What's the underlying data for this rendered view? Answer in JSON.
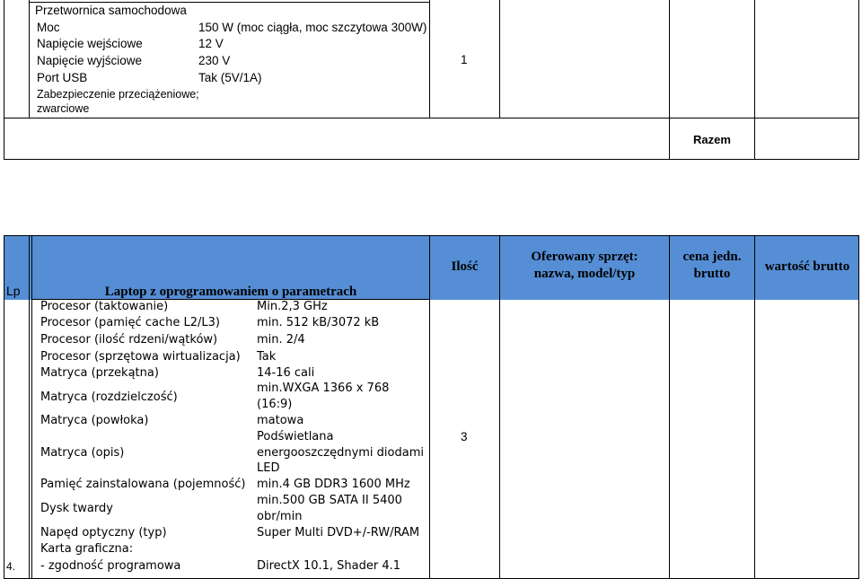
{
  "top_item": {
    "title": "Przetwornica samochodowa",
    "specs": [
      {
        "name": "Moc",
        "value": "150 W (moc ciągła, moc szczytowa 300W)"
      },
      {
        "name": "Napięcie wejściowe",
        "value": "12 V"
      },
      {
        "name": "Napięcie wyjściowe",
        "value": "230 V"
      },
      {
        "name": "Port USB",
        "value": "Tak (5V/1A)"
      }
    ],
    "protection_line1": "Zabezpieczenie przeciążeniowe;",
    "protection_line2": "zwarciowe",
    "quantity": "1"
  },
  "summary": {
    "label": "Razem"
  },
  "header": {
    "lp": "Lp",
    "title": "Laptop z oprogramowaniem o parametrach",
    "quantity": "Ilość",
    "offered_line1": "Oferowany sprzęt:",
    "offered_line2": "nazwa, model/typ",
    "price_line1": "cena jedn.",
    "price_line2": "brutto",
    "value": "wartość brutto",
    "header_bg": "#558ed5"
  },
  "laptop": {
    "number": "4.",
    "quantity": "3",
    "specs": [
      {
        "name": "Procesor (taktowanie)",
        "value": "Min.2,3 GHz"
      },
      {
        "name": "Procesor (pamięć cache L2/L3)",
        "value": "min. 512 kB/3072 kB"
      },
      {
        "name": "Procesor (ilość rdzeni/wątków)",
        "value": "min. 2/4"
      },
      {
        "name": "Procesor (sprzętowa wirtualizacja)",
        "value": "Tak"
      },
      {
        "name": "Matryca (przekątna)",
        "value": "14-16 cali"
      },
      {
        "name": "Matryca (rozdzielczość)",
        "value1": "min.WXGA 1366 x 768",
        "value2": "(16:9)"
      },
      {
        "name": "Matryca (powłoka)",
        "value": "matowa"
      },
      {
        "name": "Matryca (opis)",
        "value1": "Podświetlana",
        "value2": "energooszczędnymi diodami",
        "value3": "LED"
      },
      {
        "name": "Pamięć zainstalowana (pojemność)",
        "value": "min.4 GB DDR3 1600 MHz"
      },
      {
        "name": "Dysk twardy",
        "value1": "min.500 GB SATA II 5400",
        "value2": "obr/min"
      },
      {
        "name": "Napęd optyczny (typ)",
        "value": "Super Multi DVD+/-RW/RAM"
      },
      {
        "name": "Karta graficzna:"
      },
      {
        "name": "- zgodność programowa",
        "value": "DirectX 10.1, Shader 4.1"
      }
    ]
  }
}
